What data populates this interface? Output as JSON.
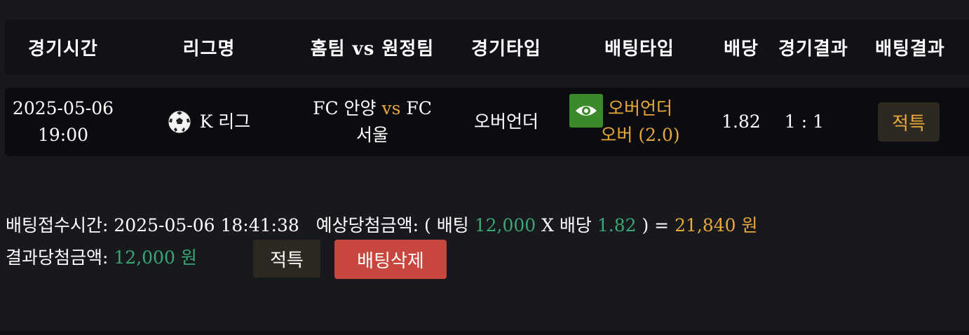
{
  "header": {
    "time": "경기시간",
    "league": "리그명",
    "teams": "홈팀 vs 원정팀",
    "match_type": "경기타입",
    "bet_type": "배팅타입",
    "odds": "배당",
    "match_result": "경기결과",
    "bet_result": "배팅결과"
  },
  "row": {
    "date": "2025-05-06",
    "time": "19:00",
    "league_icon": "soccer-ball-icon",
    "league": "K 리그",
    "home": "FC 안양",
    "vs": "vs",
    "away_line1": "FC",
    "away_line2": "서울",
    "match_type": "오버언더",
    "bet_type_label": "오버언더",
    "bet_pick": "오버 (2.0)",
    "odds": "1.82",
    "match_result": "1 : 1",
    "bet_result": "적특"
  },
  "summary": {
    "received_label": "배팅접수시간:",
    "received_time": "2025-05-06 18:41:38",
    "expected_label": "예상당첨금액:",
    "open_paren": "(",
    "bet_label": "배팅",
    "bet_amount": "12,000",
    "times": "X",
    "odds_label": "배당",
    "odds_value": "1.82",
    "close_eq": ") =",
    "expected_amount": "21,840 원",
    "result_label": "결과당첨금액:",
    "result_amount": "12,000 원",
    "result_button": "적특",
    "delete_button": "배팅삭제"
  },
  "colors": {
    "accent_gold": "#e8a83c",
    "accent_green": "#3aa776",
    "delete_red": "#c7473f"
  }
}
